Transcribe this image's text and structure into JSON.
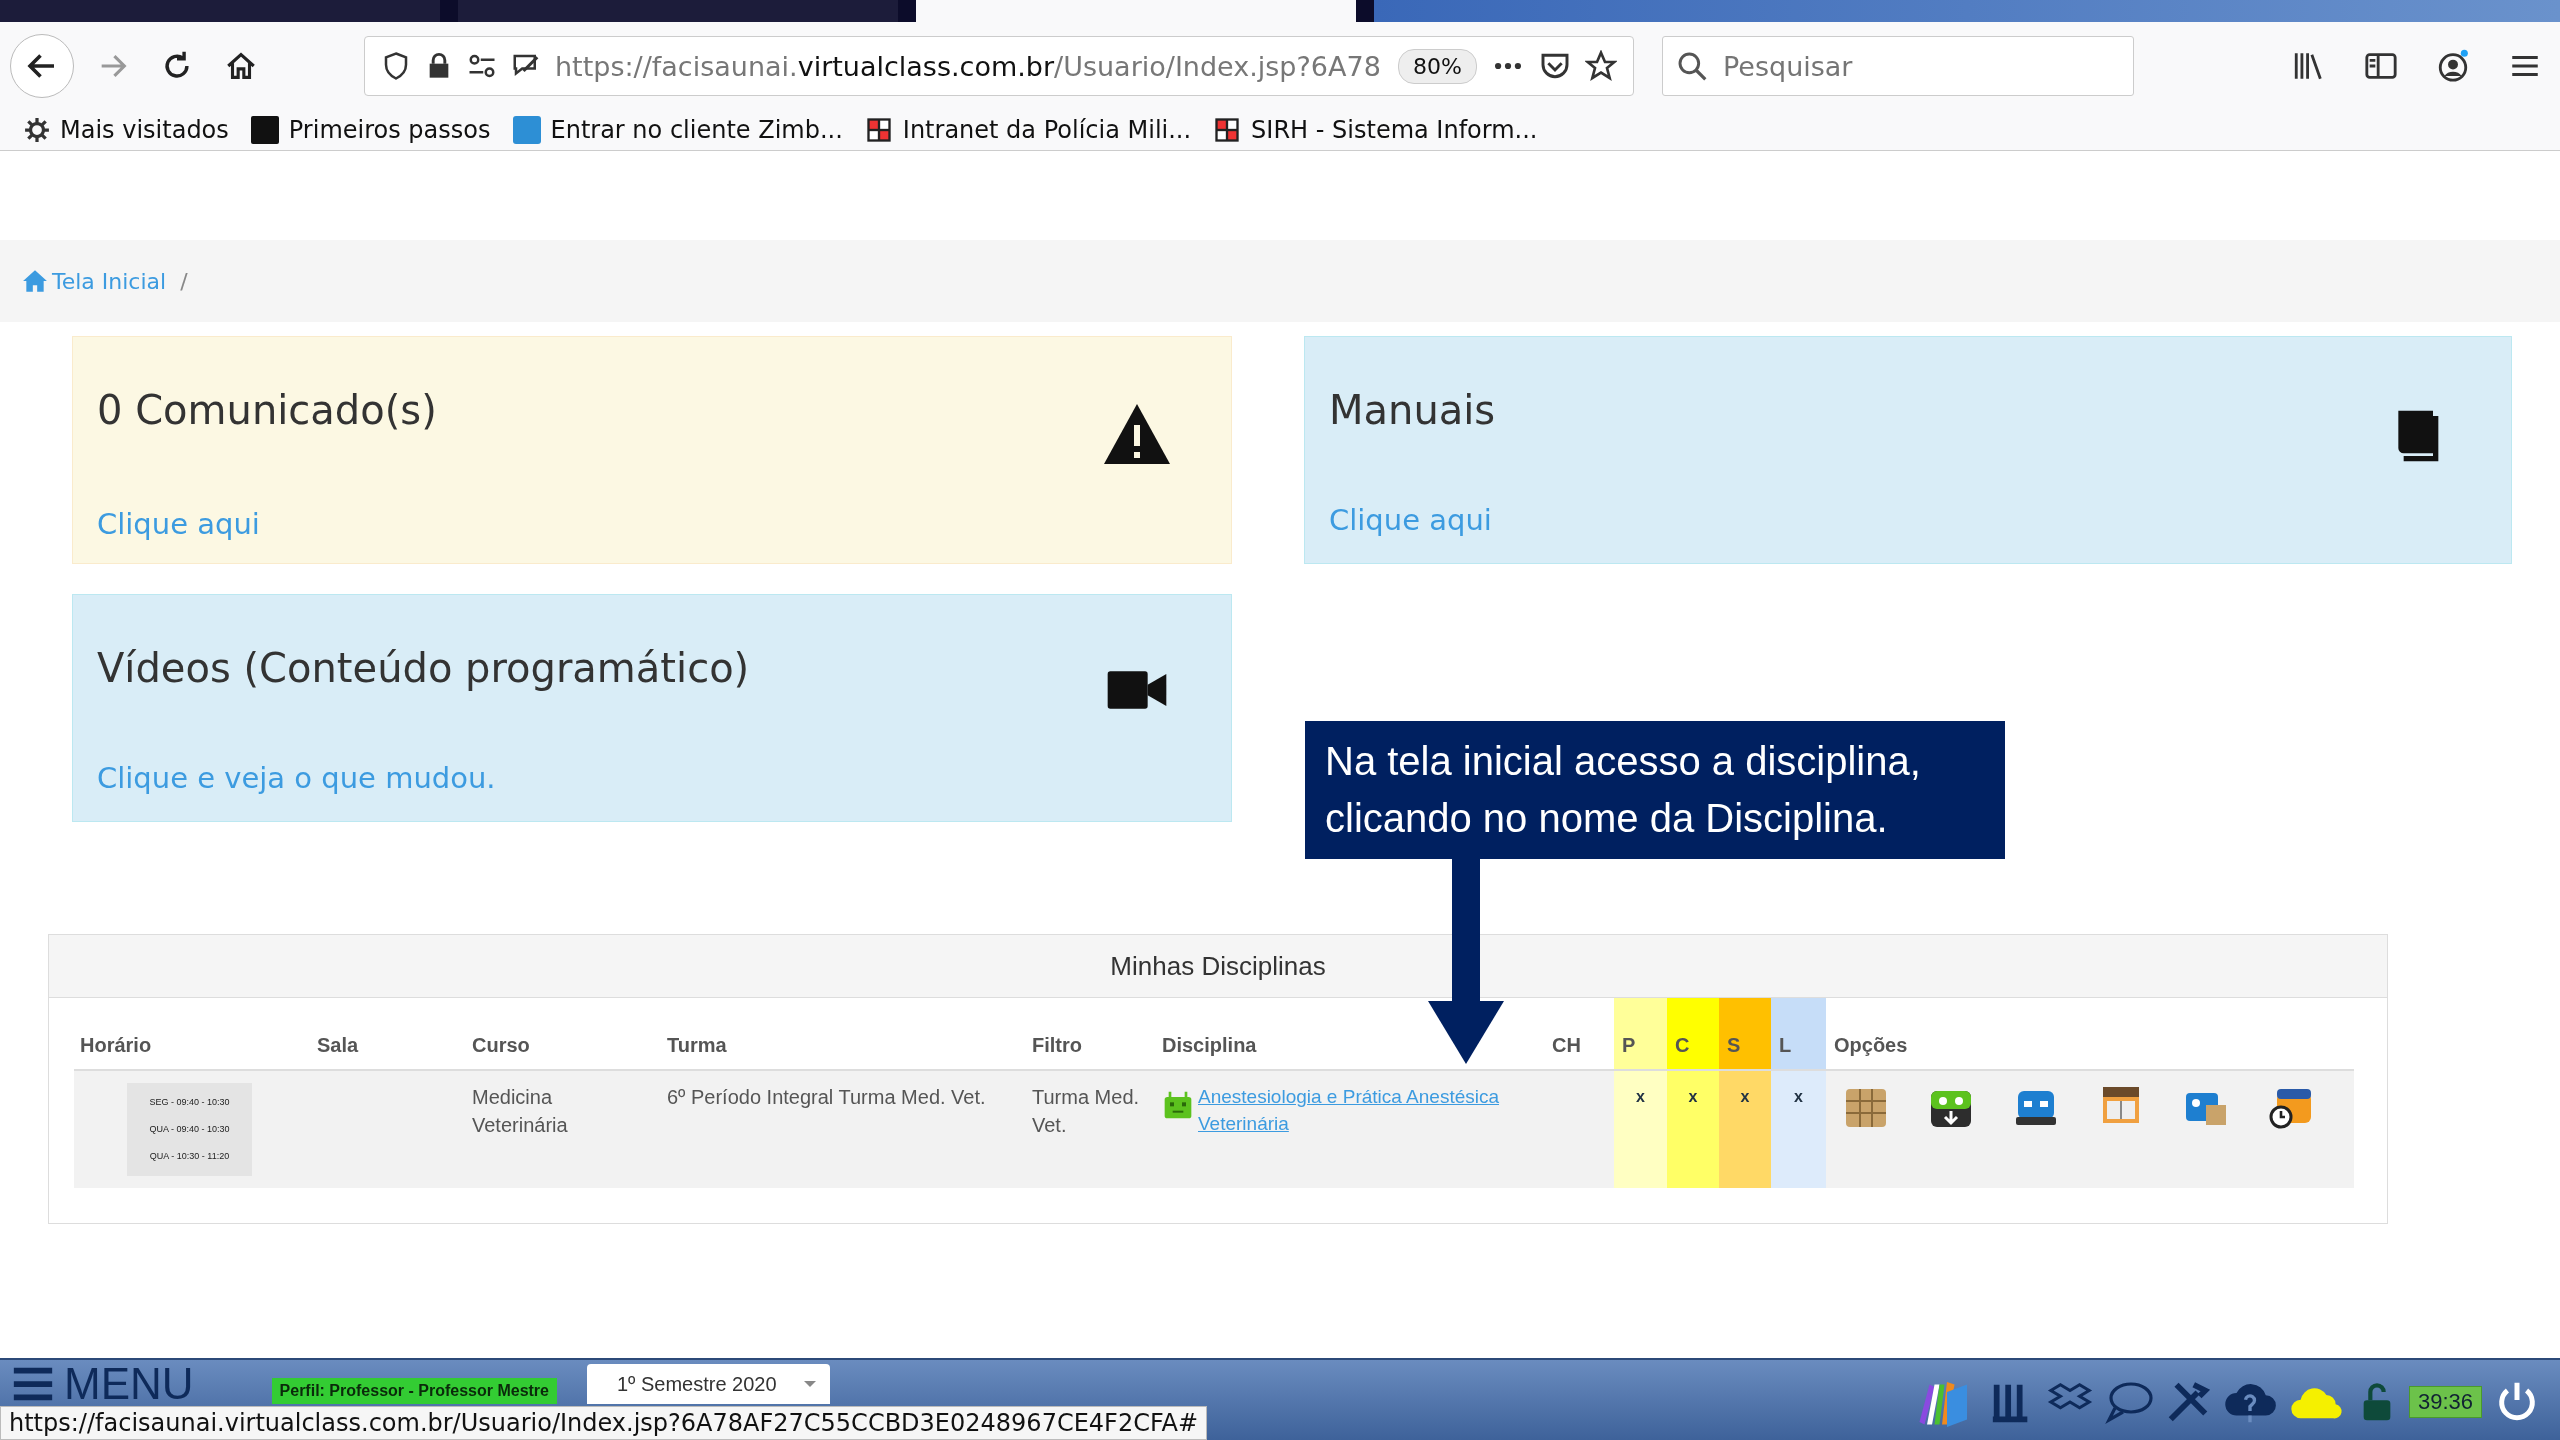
{
  "toolbar": {
    "url_prefix": "https://facisaunai.",
    "url_domain": "virtualclass.com.br",
    "url_path": "/Usuario/Index.jsp?6A78",
    "zoom": "80%",
    "search_placeholder": "Pesquisar"
  },
  "bookmarks": [
    {
      "kind": "gear",
      "label": "Mais visitados"
    },
    {
      "kind": "m",
      "label": "Primeiros passos"
    },
    {
      "kind": "z",
      "label": "Entrar no cliente Zimb..."
    },
    {
      "kind": "pm",
      "label": "Intranet da Polícia Mili..."
    },
    {
      "kind": "pm",
      "label": "SIRH - Sistema Inform..."
    }
  ],
  "breadcrumb": {
    "home": "Tela Inicial",
    "separator": "/"
  },
  "cards": [
    {
      "kind": "warning",
      "title": "0 Comunicado(s)",
      "link": "Clique aqui"
    },
    {
      "kind": "book",
      "title": "Manuais",
      "link": "Clique aqui"
    },
    {
      "kind": "video",
      "title": "Vídeos (Conteúdo programático)",
      "link": "Clique e veja o que mudou."
    }
  ],
  "callout": {
    "text": "Na tela inicial acesso a disciplina, clicando no nome da Disciplina."
  },
  "table": {
    "title": "Minhas Disciplinas",
    "columns": [
      {
        "label": "Horário"
      },
      {
        "label": "Sala"
      },
      {
        "label": "Curso"
      },
      {
        "label": "Turma"
      },
      {
        "label": "Filtro"
      },
      {
        "label": "Disciplina"
      },
      {
        "label": "CH"
      },
      {
        "label": "P",
        "color": "#ffff99"
      },
      {
        "label": "C",
        "color": "#ffff00"
      },
      {
        "label": "S",
        "color": "#ffc000"
      },
      {
        "label": "L",
        "color": "#c6ddf8"
      },
      {
        "label": "Opções"
      }
    ],
    "rows": [
      {
        "horario": [
          "SEG - 09:40 - 10:30",
          "QUA - 09:40 - 10:30",
          "QUA - 10:30 - 11:20"
        ],
        "curso": "Medicina Veterinária",
        "turma": "6º Período Integral Turma Med. Vet.",
        "filtro": "Turma Med. Vet.",
        "disciplina": "Anestesiologia e Prática Anestésica Veterinária",
        "marks": [
          "x",
          "x",
          "x",
          "x"
        ]
      }
    ]
  },
  "taskbar": {
    "menu": "MENU",
    "profile": "Perfil: Professor - Professor Mestre",
    "semester": "1º Semestre 2020",
    "timer": "39:36",
    "status_url": "https://facisaunai.virtualclass.com.br/Usuario/Index.jsp?6A78AF27C55CCBD3E0248967CE4F2CFA#"
  }
}
